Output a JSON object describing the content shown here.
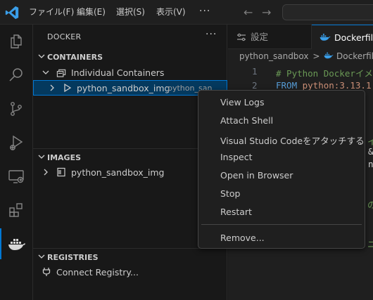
{
  "titlebar": {
    "menus": [
      "ファイル(F)",
      "編集(E)",
      "選択(S)",
      "表示(V)"
    ],
    "more": "···",
    "back": "←",
    "forward": "→"
  },
  "activity_bar": {
    "items": [
      "explorer-icon",
      "search-icon",
      "source-control-icon",
      "run-debug-icon",
      "remote-explorer-icon",
      "extensions-icon",
      "docker-icon"
    ],
    "active": "docker-icon"
  },
  "sidebar": {
    "title": "DOCKER",
    "more": "···",
    "containers": {
      "header": "CONTAINERS",
      "group": "Individual Containers",
      "item_label": "python_sandbox_img",
      "item_desc": "python_san"
    },
    "images": {
      "header": "IMAGES",
      "item_label": "python_sandbox_img"
    },
    "registries": {
      "header": "REGISTRIES",
      "item_label": "Connect Registry..."
    }
  },
  "editor": {
    "tabs": [
      {
        "label": "設定"
      },
      {
        "label": "Dockerfile"
      }
    ],
    "breadcrumb": {
      "folder": "python_sandbox",
      "sep": ">",
      "file": "Dockerfile"
    },
    "lines": [
      {
        "num": "1",
        "text": "# Python Dockerイメ"
      },
      {
        "num": "2",
        "keyword": "FROM",
        "text": " python:3.13.1"
      }
    ],
    "peek_fragments": [
      "イ",
      "&",
      "n",
      "の",
      "ニ"
    ]
  },
  "context_menu": {
    "items": [
      "View Logs",
      "Attach Shell",
      "Visual Studio Codeをアタッチする",
      "Inspect",
      "Open in Browser",
      "Stop",
      "Restart"
    ],
    "after_separator": [
      "Remove..."
    ]
  },
  "colors": {
    "accent": "#0078d4",
    "selection": "#04395e",
    "comment": "#6a9955",
    "keyword": "#569cd6",
    "string": "#ce9178"
  }
}
